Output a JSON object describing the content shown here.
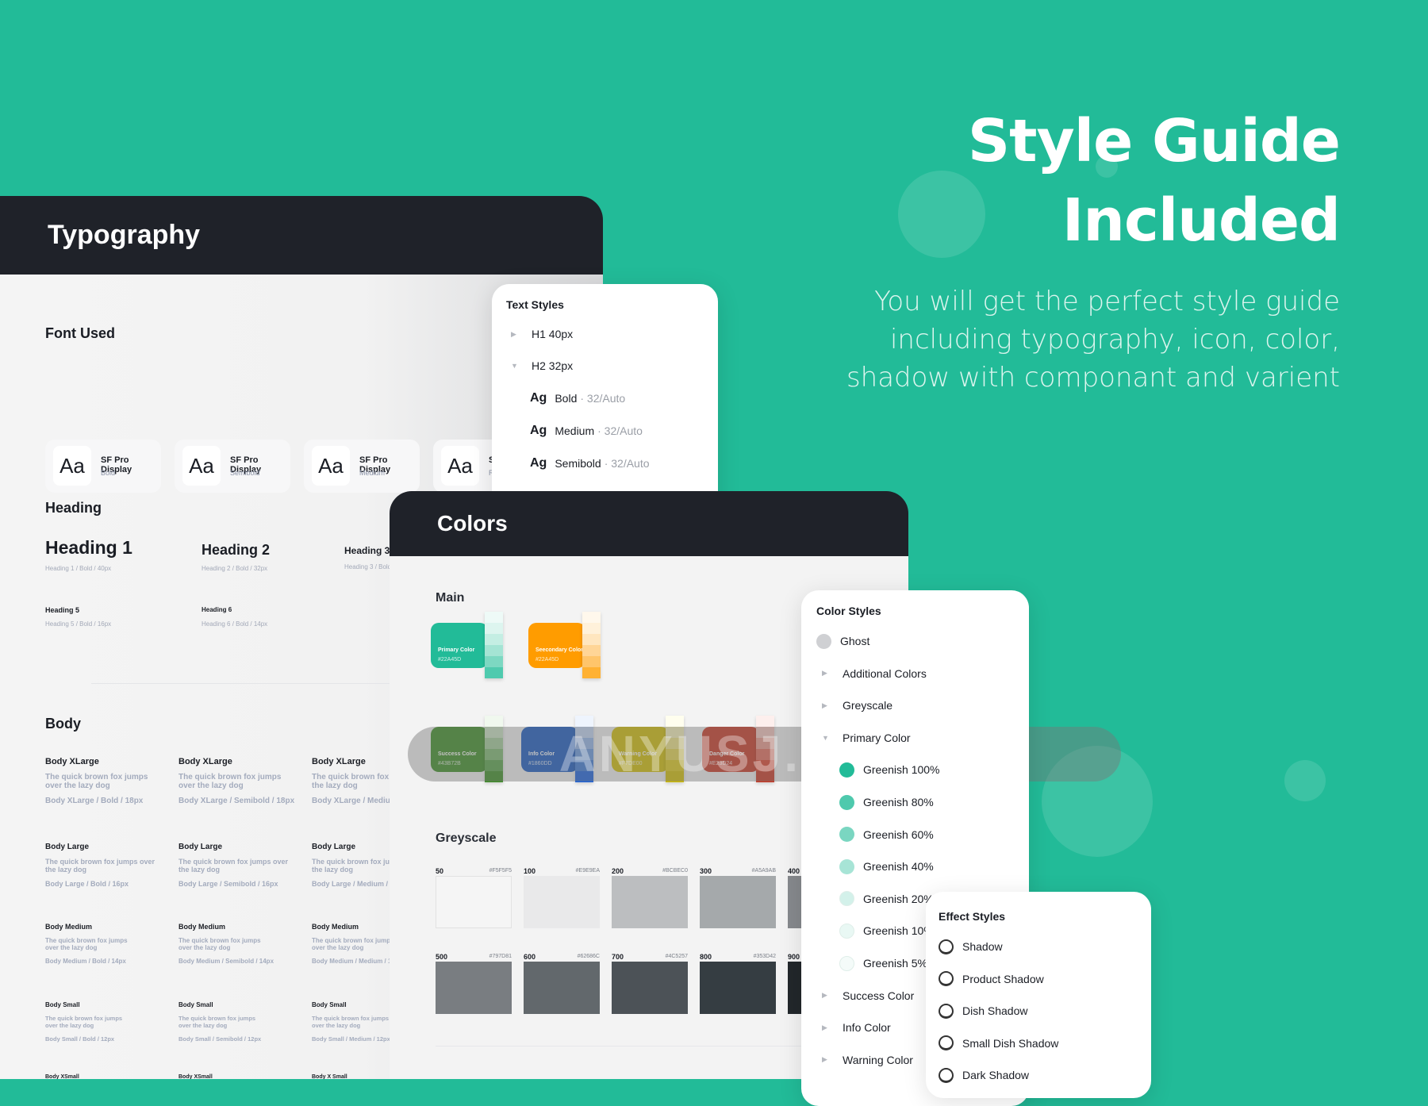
{
  "hero": {
    "title_line1": "Style Guide",
    "title_line2": "Included",
    "subtitle_lines": [
      "You will get the perfect style guide",
      "including typography, icon, color,",
      "shadow with componant and varient"
    ]
  },
  "watermark": "ANYUSJ.COM®",
  "colors_theme": {
    "background": "#22BB98",
    "dark": "#1F2229"
  },
  "typography": {
    "title": "Typography",
    "font_used_label": "Font Used",
    "fonts": [
      {
        "sample": "Aa",
        "name": "SF Pro Display",
        "weight": "Bold"
      },
      {
        "sample": "Aa",
        "name": "SF Pro Display",
        "weight": "Semibold"
      },
      {
        "sample": "Aa",
        "name": "SF Pro Display",
        "weight": "Medium"
      },
      {
        "sample": "Aa",
        "name": "S",
        "weight": "R"
      }
    ],
    "heading_label": "Heading",
    "headings": [
      {
        "name": "Heading 1",
        "meta": "Heading 1 / Bold / 40px"
      },
      {
        "name": "Heading 2",
        "meta": "Heading 2 / Bold / 32px"
      },
      {
        "name": "Heading 3",
        "meta": "Heading 3 / Bold /"
      },
      {
        "name": "Heading 5",
        "meta": "Heading 5 / Bold / 16px"
      },
      {
        "name": "Heading 6",
        "meta": "Heading 6 / Bold / 14px"
      }
    ],
    "body_label": "Body",
    "body_rows": [
      {
        "cols": [
          {
            "title": "Body XLarge",
            "sample": "The quick brown fox jumps over the lazy dog",
            "meta": "Body XLarge / Bold / 18px"
          },
          {
            "title": "Body XLarge",
            "sample": "The quick brown fox jumps over the lazy dog",
            "meta": "Body XLarge / Semibold / 18px"
          },
          {
            "title": "Body XLarge",
            "sample": "The quick brown fox j over the lazy dog",
            "meta": "Body XLarge / Mediur"
          }
        ]
      },
      {
        "cols": [
          {
            "title": "Body Large",
            "sample": "The quick brown fox jumps over the lazy dog",
            "meta": "Body Large / Bold / 16px"
          },
          {
            "title": "Body Large",
            "sample": "The quick brown fox jumps over the lazy dog",
            "meta": "Body Large / Semibold / 16px"
          },
          {
            "title": "Body Large",
            "sample": "The quick brown fox jum over the lazy dog",
            "meta": "Body Large / Medium / 1"
          }
        ]
      },
      {
        "cols": [
          {
            "title": "Body Medium",
            "sample": "The quick brown fox jumps over the lazy dog",
            "meta": "Body Medium / Bold / 14px"
          },
          {
            "title": "Body Medium",
            "sample": "The quick brown fox jumps over the lazy dog",
            "meta": "Body Medium / Semibold / 14px"
          },
          {
            "title": "Body Medium",
            "sample": "The quick brown fox jumps over the lazy dog",
            "meta": "Body Medium / Medium / 14"
          }
        ]
      },
      {
        "cols": [
          {
            "title": "Body Small",
            "sample": "The quick brown fox jumps over the lazy dog",
            "meta": "Body Small / Bold / 12px"
          },
          {
            "title": "Body Small",
            "sample": "The quick brown fox jumps over the lazy dog",
            "meta": "Body Small / Semibold / 12px"
          },
          {
            "title": "Body Small",
            "sample": "The quick brown fox jumps over the lazy dog",
            "meta": "Body Small / Medium / 12px"
          }
        ]
      },
      {
        "cols": [
          {
            "title": "Body XSmall"
          },
          {
            "title": "Body XSmall"
          },
          {
            "title": "Body X Small"
          }
        ]
      }
    ]
  },
  "text_styles": {
    "title": "Text Styles",
    "items": [
      {
        "label": "H1 40px",
        "state": "collapsed"
      },
      {
        "label": "H2 32px",
        "state": "expanded"
      }
    ],
    "sub_items": [
      {
        "glyph": "Ag",
        "weight": "Bold",
        "spec": "· 32/Auto"
      },
      {
        "glyph": "Ag",
        "weight": "Medium",
        "spec": "· 32/Auto"
      },
      {
        "glyph": "Ag",
        "weight": "Semibold",
        "spec": "· 32/Auto"
      }
    ]
  },
  "colors": {
    "title": "Colors",
    "main_label": "Main",
    "main": [
      {
        "name": "Primary Color",
        "hex": "#22A45D",
        "color": "#22BB98",
        "tints": [
          "#EEFAF7",
          "#DDF5EF",
          "#C4EEE3",
          "#A4E4D4",
          "#7DD8C2",
          "#4FCAAE"
        ]
      },
      {
        "name": "Seecondary Color",
        "hex": "#22A45D",
        "color": "#FF9C00",
        "tints": [
          "#FFF8EC",
          "#FFF1DA",
          "#FFE6BF",
          "#FFD596",
          "#FFC56B",
          "#FFB133"
        ]
      }
    ],
    "status": [
      {
        "name": "Success Color",
        "hex": "#43B72B",
        "color": "#3A8D22",
        "tints": [
          "#F0F8EE",
          "#C9E2C2",
          "#A3CD99",
          "#7DB870",
          "#57A347",
          "#3A8D22"
        ]
      },
      {
        "name": "Info Color",
        "hex": "#1860DD",
        "color": "#1557BF",
        "tints": [
          "#EEF4FD",
          "#BFD3F3",
          "#93B5E9",
          "#6797DF",
          "#3B79D5",
          "#1860DD"
        ]
      },
      {
        "name": "Warning Color",
        "hex": "#F7DE00",
        "color": "#D1BE00",
        "tints": [
          "#FFFEEE",
          "#F6F0B8",
          "#EEE383",
          "#E6D64D",
          "#DECA18",
          "#D1BE00"
        ]
      },
      {
        "name": "Danger Color",
        "hex": "#E23D24",
        "color": "#C93420",
        "tints": [
          "#FDEFED",
          "#F4C3BC",
          "#EC978B",
          "#E46B5A",
          "#DC3F29",
          "#C93420"
        ]
      }
    ],
    "greyscale_label": "Greyscale",
    "greyscale": [
      {
        "step": "50",
        "hex": "#F5F5F5"
      },
      {
        "step": "100",
        "hex": "#E9E9EA"
      },
      {
        "step": "200",
        "hex": "#BCBEC0"
      },
      {
        "step": "300",
        "hex": "#A5A9AB"
      },
      {
        "step": "400",
        "hex": "",
        "color": "#86898D"
      },
      {
        "step": "500",
        "hex": "#797D81"
      },
      {
        "step": "600",
        "hex": "#62686C"
      },
      {
        "step": "700",
        "hex": "#4C5257"
      },
      {
        "step": "800",
        "hex": "#353D42"
      },
      {
        "step": "900",
        "hex": "",
        "color": "#22272B"
      }
    ]
  },
  "color_styles": {
    "title": "Color Styles",
    "items": [
      {
        "label": "Ghost",
        "type": "swatch",
        "color": "#CFD0D3"
      },
      {
        "label": "Additional Colors",
        "type": "collapsed"
      },
      {
        "label": "Greyscale",
        "type": "collapsed"
      },
      {
        "label": "Primary Color",
        "type": "expanded"
      },
      {
        "label": "Greenish 100%",
        "type": "child",
        "color": "#22BB98"
      },
      {
        "label": "Greenish 80%",
        "type": "child",
        "color": "#4EC9AD"
      },
      {
        "label": "Greenish 60%",
        "type": "child",
        "color": "#7AD6C1"
      },
      {
        "label": "Greenish 40%",
        "type": "child",
        "color": "#A7E4D6"
      },
      {
        "label": "Greenish 20%",
        "type": "child",
        "color": "#D3F1EA"
      },
      {
        "label": "Greenish 10%",
        "type": "child",
        "color": "#E9F8F4"
      },
      {
        "label": "Greenish 5%",
        "type": "child",
        "color": "#F4FBF9"
      },
      {
        "label": "Success Color",
        "type": "collapsed"
      },
      {
        "label": "Info Color",
        "type": "collapsed"
      },
      {
        "label": "Warning Color",
        "type": "collapsed"
      }
    ]
  },
  "effect_styles": {
    "title": "Effect Styles",
    "items": [
      "Shadow",
      "Product Shadow",
      "Dish Shadow",
      "Small Dish Shadow",
      "Dark Shadow"
    ]
  }
}
